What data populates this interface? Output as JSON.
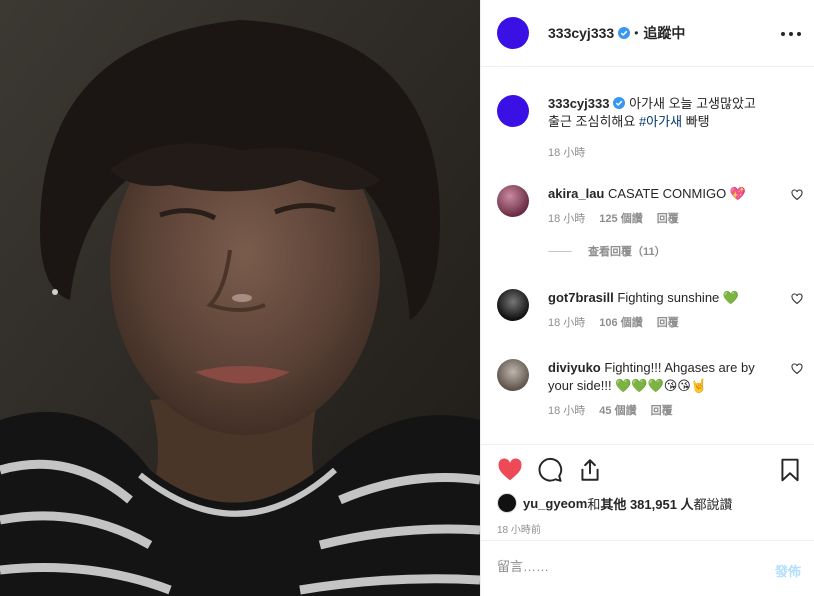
{
  "post": {
    "author": "333cyj333",
    "follow_status": "追蹤中",
    "avatar_color": "#3a10e5"
  },
  "caption": {
    "user": "333cyj333",
    "text": "아가새 오늘 고생많았고 출근 조심히해요 ",
    "hashtag": "#아가새",
    "tail": " 빠탱",
    "time": "18 小時"
  },
  "comments": [
    {
      "user": "akira_lau",
      "text": "CASATE CONMIGO 💖",
      "time": "18 小時",
      "likes": "125 個讚",
      "reply": "回覆",
      "view_replies": "查看回覆（11）"
    },
    {
      "user": "got7brasill",
      "text": "Fighting sunshine 💚",
      "time": "18 小時",
      "likes": "106 個讚",
      "reply": "回覆"
    },
    {
      "user": "diviyuko",
      "text": "Fighting!!! Ahgases are by your side!!! 💚💚💚😘😘🤘",
      "time": "18 小時",
      "likes": "45 個讚",
      "reply": "回覆"
    }
  ],
  "likes": {
    "user": "yu_gyeom",
    "and": " 和 ",
    "others": "其他 381,951 人",
    "suffix": " 都說讚"
  },
  "timestamp": "18 小時前",
  "compose": {
    "placeholder": "留言……",
    "post_label": "發佈"
  },
  "colors": {
    "like_active": "#ed4956",
    "link": "#00376b",
    "verified": "#3897f0",
    "muted": "#8e8e8e"
  }
}
